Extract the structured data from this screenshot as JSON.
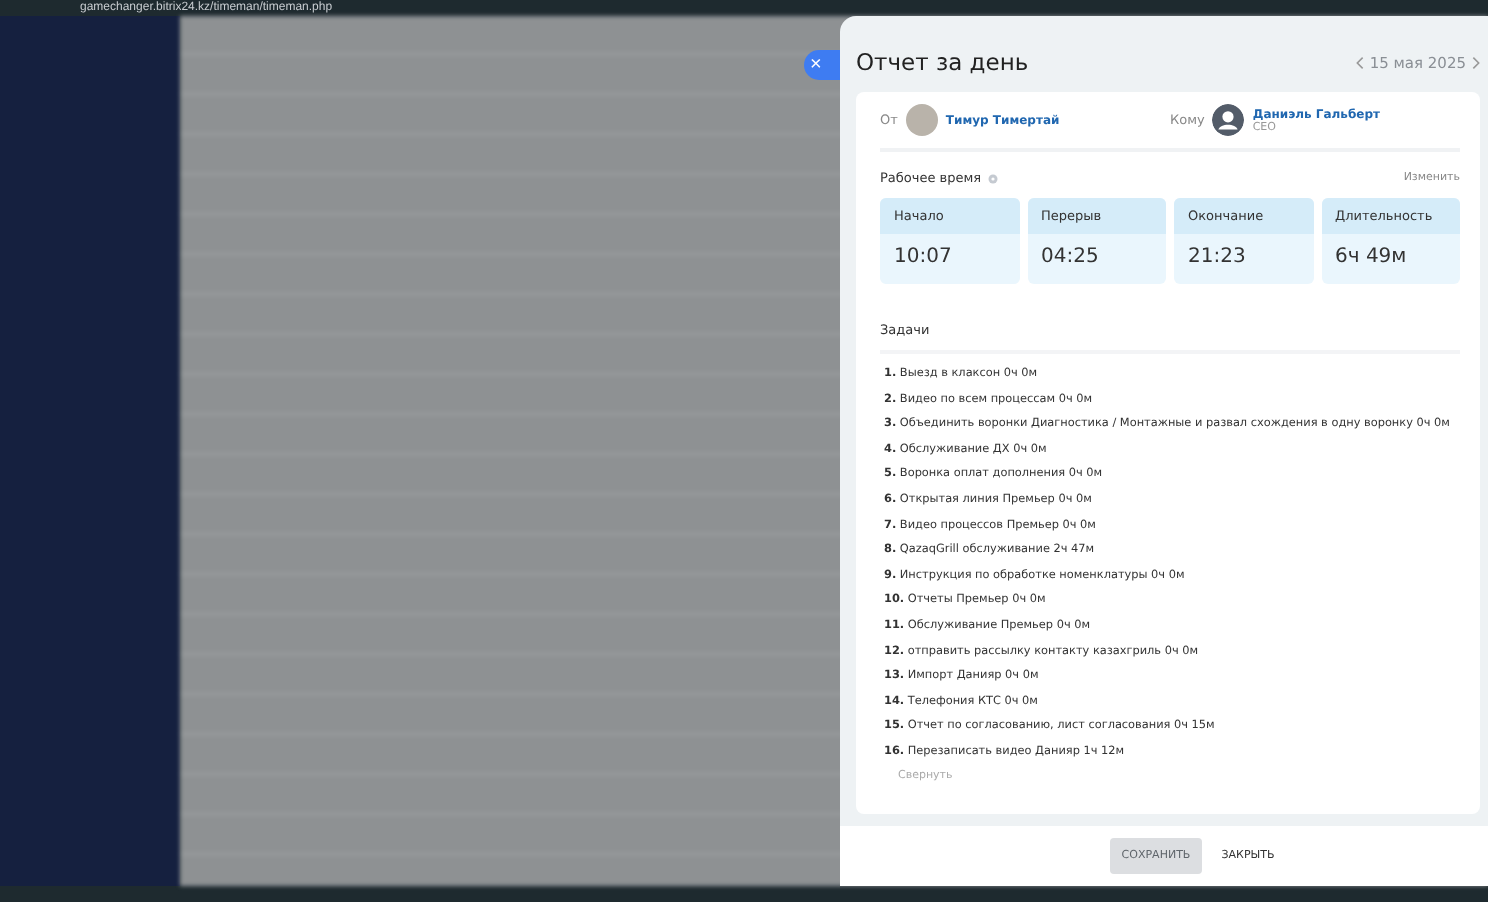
{
  "browser": {
    "url": "gamechanger.bitrix24.kz/timeman/timeman.php"
  },
  "close_button": {
    "label": "×"
  },
  "panel": {
    "title": "Отчет за день",
    "date": "15 мая 2025",
    "from": {
      "label": "От",
      "name": "Тимур Тимертай"
    },
    "to": {
      "label": "Кому",
      "name": "Даниэль Гальберт",
      "role": "CEO"
    },
    "work_time": {
      "title": "Рабочее время",
      "edit": "Изменить",
      "cells": [
        {
          "label": "Начало",
          "value": "10:07"
        },
        {
          "label": "Перерыв",
          "value": "04:25"
        },
        {
          "label": "Окончание",
          "value": "21:23"
        },
        {
          "label": "Длительность",
          "value": "6ч 49м"
        }
      ]
    },
    "tasks": {
      "title": "Задачи",
      "collapse": "Свернуть",
      "items": [
        "**1.** Выезд в клаксон 0ч 0м",
        "**2.** Видео по всем процессам 0ч 0м",
        "**3.** Объединить воронки Диагностика / Монтажные и развал схождения в одну воронку 0ч 0м",
        "**4.** Обслуживание ДХ 0ч 0м",
        "**5.** Воронка оплат дополнения 0ч 0м",
        "**6.** Открытая линия Премьер 0ч 0м",
        "**7.** Видео процессов Премьер 0ч 0м",
        "**8.** QazaqGrill обслуживание 2ч 47м",
        "**9.** Инструкция по обработке номенклатуры 0ч 0м",
        "**10.** Отчеты Премьер 0ч 0м",
        "**11.** Обслуживание Премьер 0ч 0м",
        "**12.** отправить рассылку контакту казахгриль 0ч 0м",
        "**13.** Импорт Данияр 0ч 0м",
        "**14.** Телефония КТС 0ч 0м",
        "**15.** Отчет по согласованию, лист согласования 0ч 15м",
        "**16.** Перезаписать видео Данияр 1ч 12м"
      ]
    },
    "buttons": [
      {
        "label": "СОХРАНИТЬ",
        "disabled": true
      },
      {
        "label": "ЗАКРЫТЬ",
        "disabled": false
      }
    ]
  }
}
